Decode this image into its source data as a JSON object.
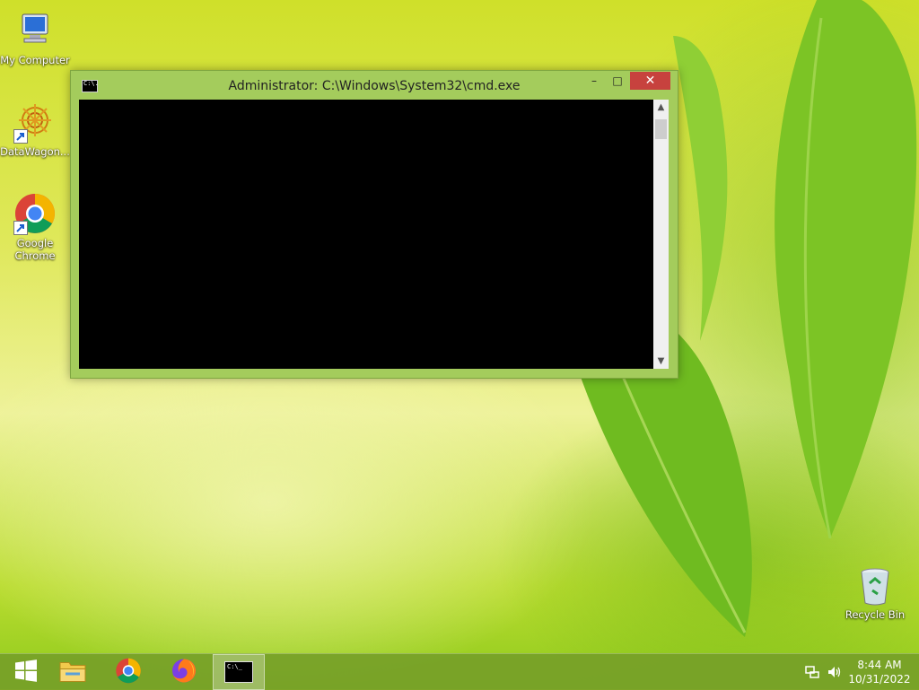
{
  "desktop": {
    "icons": [
      {
        "label": "My Computer",
        "icon": "computer-icon"
      },
      {
        "label": "DataWagon...",
        "icon": "datawagon-icon"
      },
      {
        "label": "Google Chrome",
        "icon": "chrome-icon"
      },
      {
        "label": "Recycle Bin",
        "icon": "recycle-bin-icon"
      }
    ]
  },
  "window": {
    "title": "Administrator: C:\\Windows\\System32\\cmd.exe",
    "icon_text": "C:\\.",
    "minimize_glyph": "–",
    "maximize_glyph": "□",
    "close_glyph": "✕",
    "scroll_up_glyph": "▲",
    "scroll_down_glyph": "▼"
  },
  "taskbar": {
    "items": [
      {
        "name": "start",
        "icon": "windows-logo-icon"
      },
      {
        "name": "file-explorer",
        "icon": "folder-icon"
      },
      {
        "name": "chrome",
        "icon": "chrome-icon"
      },
      {
        "name": "firefox",
        "icon": "firefox-icon"
      },
      {
        "name": "cmd",
        "icon": "cmd-icon",
        "active": true,
        "label": "C:\\_"
      }
    ],
    "time": "8:44 AM",
    "date": "10/31/2022"
  },
  "colors": {
    "close_button": "#c7423e",
    "window_frame": "#a4cc5c",
    "taskbar": "#76a028"
  }
}
